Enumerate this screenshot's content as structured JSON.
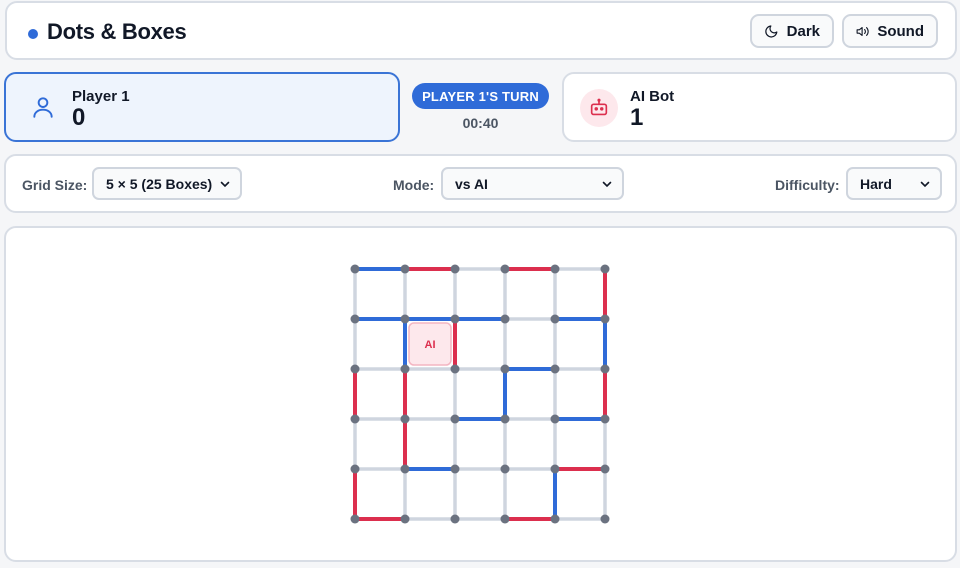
{
  "header": {
    "title": "Dots & Boxes",
    "dark_label": "Dark",
    "sound_label": "Sound"
  },
  "players": {
    "p1": {
      "name": "Player 1",
      "score": "0"
    },
    "ai": {
      "name": "AI Bot",
      "score": "1"
    }
  },
  "turn": {
    "label": "PLAYER 1'S TURN",
    "timer": "00:40"
  },
  "settings": {
    "grid_label": "Grid Size:",
    "grid_value": "5 × 5 (25 Boxes)",
    "mode_label": "Mode:",
    "mode_value": "vs AI",
    "difficulty_label": "Difficulty:",
    "difficulty_value": "Hard"
  },
  "colors": {
    "player": "#2f6bd8",
    "ai": "#dc2f4e",
    "empty_line": "#cfd5df",
    "dot": "#6b7280"
  },
  "board": {
    "size": 5,
    "horizontal": [
      [
        "p",
        "a",
        "",
        "a",
        ""
      ],
      [
        "p",
        "p",
        "p",
        "",
        "p"
      ],
      [
        "",
        "",
        "",
        "p",
        ""
      ],
      [
        "",
        "",
        "p",
        "",
        "p"
      ],
      [
        "",
        "p",
        "",
        "",
        "a"
      ],
      [
        "a",
        "",
        "",
        "a",
        ""
      ]
    ],
    "vertical": [
      [
        "",
        "",
        "",
        "",
        "",
        "a"
      ],
      [
        "",
        "p",
        "a",
        "",
        "",
        "p"
      ],
      [
        "a",
        "a",
        "",
        "p",
        "",
        "a"
      ],
      [
        "",
        "a",
        "",
        "",
        "",
        ""
      ],
      [
        "a",
        "",
        "",
        "",
        "p",
        ""
      ]
    ],
    "boxes": [
      {
        "row": 1,
        "col": 1,
        "owner_label": "AI"
      }
    ]
  }
}
